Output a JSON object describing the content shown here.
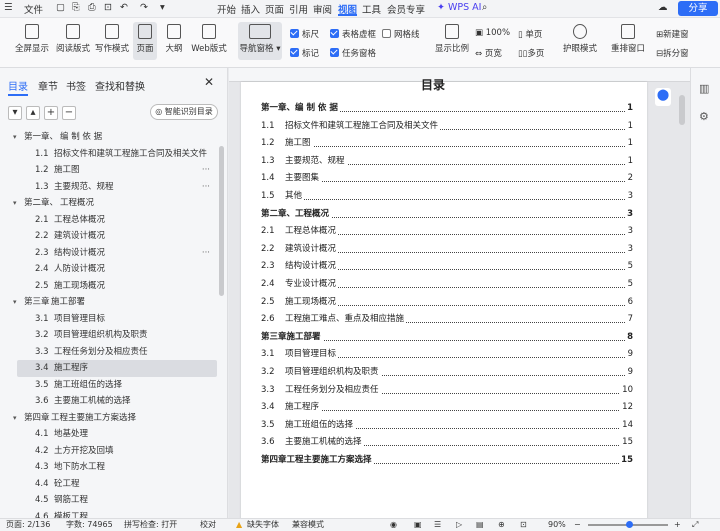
{
  "titlebar": {
    "file": "文件",
    "tabs": [
      "开始",
      "插入",
      "页面",
      "引用",
      "审阅",
      "视图",
      "工具",
      "会员专享"
    ],
    "active_tab": "视图",
    "wps_ai": "WPS AI",
    "share": "分享"
  },
  "ribbon": {
    "buttons": [
      "全屏显示",
      "阅读版式",
      "写作模式",
      "页面",
      "大纲",
      "Web版式"
    ],
    "nav": "导航窗格",
    "checks": [
      {
        "label": "标尺",
        "on": true
      },
      {
        "label": "表格虚框",
        "on": true
      },
      {
        "label": "网格线",
        "on": false
      },
      {
        "label": "标记",
        "on": true
      },
      {
        "label": "任务窗格",
        "on": true
      }
    ],
    "zoom_btn": "显示比例",
    "zoom100": "100%",
    "page_width": "页宽",
    "single": "单页",
    "multi": "多页",
    "eye": "护眼模式",
    "rearrange": "重排窗口",
    "new_window": "新建窗",
    "split": "拆分窗"
  },
  "sidebar": {
    "tabs": [
      "目录",
      "章节",
      "书签",
      "查找和替换"
    ],
    "active": "目录",
    "smart_btn": "智能识别目录",
    "items": [
      {
        "lvl": 1,
        "num": "第一章、",
        "label": "编 制 依 据"
      },
      {
        "lvl": 2,
        "num": "1.1",
        "label": "招标文件和建筑工程施工合同及相关文件"
      },
      {
        "lvl": 2,
        "num": "1.2",
        "label": "施工图",
        "dots": true
      },
      {
        "lvl": 2,
        "num": "1.3",
        "label": "主要规范、规程",
        "dots": true
      },
      {
        "lvl": 1,
        "num": "第二章、",
        "label": "工程概况"
      },
      {
        "lvl": 2,
        "num": "2.1",
        "label": "工程总体概况"
      },
      {
        "lvl": 2,
        "num": "2.2",
        "label": "建筑设计概况"
      },
      {
        "lvl": 2,
        "num": "2.3",
        "label": "结构设计概况",
        "dots": true
      },
      {
        "lvl": 2,
        "num": "2.4",
        "label": "人防设计概况"
      },
      {
        "lvl": 2,
        "num": "2.5",
        "label": "施工现场概况"
      },
      {
        "lvl": 1,
        "num": "第三章",
        "label": "施工部署"
      },
      {
        "lvl": 2,
        "num": "3.1",
        "label": "项目管理目标"
      },
      {
        "lvl": 2,
        "num": "3.2",
        "label": "项目管理组织机构及职责"
      },
      {
        "lvl": 2,
        "num": "3.3",
        "label": "工程任务划分及相应责任"
      },
      {
        "lvl": 2,
        "num": "3.4",
        "label": "施工程序",
        "sel": true
      },
      {
        "lvl": 2,
        "num": "3.5",
        "label": "施工班组伍的选择"
      },
      {
        "lvl": 2,
        "num": "3.6",
        "label": "主要施工机械的选择"
      },
      {
        "lvl": 1,
        "num": "第四章",
        "label": "工程主要施工方案选择"
      },
      {
        "lvl": 2,
        "num": "4.1",
        "label": "地基处理"
      },
      {
        "lvl": 2,
        "num": "4.2",
        "label": "土方开挖及回填"
      },
      {
        "lvl": 2,
        "num": "4.3",
        "label": "地下防水工程"
      },
      {
        "lvl": 2,
        "num": "4.4",
        "label": "砼工程"
      },
      {
        "lvl": 2,
        "num": "4.5",
        "label": "钢筋工程"
      },
      {
        "lvl": 2,
        "num": "4.6",
        "label": "模板工程"
      }
    ]
  },
  "doc": {
    "title": "目录",
    "lines": [
      {
        "ch": true,
        "num": "第一章、",
        "label": "编 制 依 据",
        "page": "1"
      },
      {
        "num": "1.1",
        "label": "招标文件和建筑工程施工合同及相关文件",
        "page": "1"
      },
      {
        "num": "1.2",
        "label": "施工图",
        "page": "1"
      },
      {
        "num": "1.3",
        "label": "主要规范、规程",
        "page": "1"
      },
      {
        "num": "1.4",
        "label": "主要图集",
        "page": "2"
      },
      {
        "num": "1.5",
        "label": "其他",
        "page": "3"
      },
      {
        "ch": true,
        "num": "第二章、",
        "label": "工程概况",
        "page": "3"
      },
      {
        "num": "2.1",
        "label": "工程总体概况",
        "page": "3"
      },
      {
        "num": "2.2",
        "label": "建筑设计概况",
        "page": "3"
      },
      {
        "num": "2.3",
        "label": "结构设计概况",
        "page": "5"
      },
      {
        "num": "2.4",
        "label": "专业设计概况",
        "page": "5"
      },
      {
        "num": "2.5",
        "label": "施工现场概况",
        "page": "6"
      },
      {
        "num": "2.6",
        "label": "工程施工难点、重点及相应措施",
        "page": "7"
      },
      {
        "ch": true,
        "num": "第三章",
        "label": "施工部署",
        "page": "8"
      },
      {
        "num": "3.1",
        "label": "项目管理目标",
        "page": "9"
      },
      {
        "num": "3.2",
        "label": "项目管理组织机构及职责",
        "page": "9"
      },
      {
        "num": "3.3",
        "label": "工程任务划分及相应责任",
        "page": "10"
      },
      {
        "num": "3.4",
        "label": "施工程序",
        "page": "12"
      },
      {
        "num": "3.5",
        "label": "施工班组伍的选择",
        "page": "14"
      },
      {
        "num": "3.6",
        "label": "主要施工机械的选择",
        "page": "15"
      },
      {
        "ch": true,
        "num": "第四章",
        "label": "工程主要施工方案选择",
        "page": "15"
      }
    ]
  },
  "status": {
    "page": "页面: 2/136",
    "words": "字数: 74965",
    "spell": "拼写检查: 打开",
    "proof": "校对",
    "missing_font": "缺失字体",
    "compat": "兼容模式",
    "zoom": "90%"
  },
  "colors": {
    "accent": "#2d6df6",
    "warn": "#e8a317"
  }
}
